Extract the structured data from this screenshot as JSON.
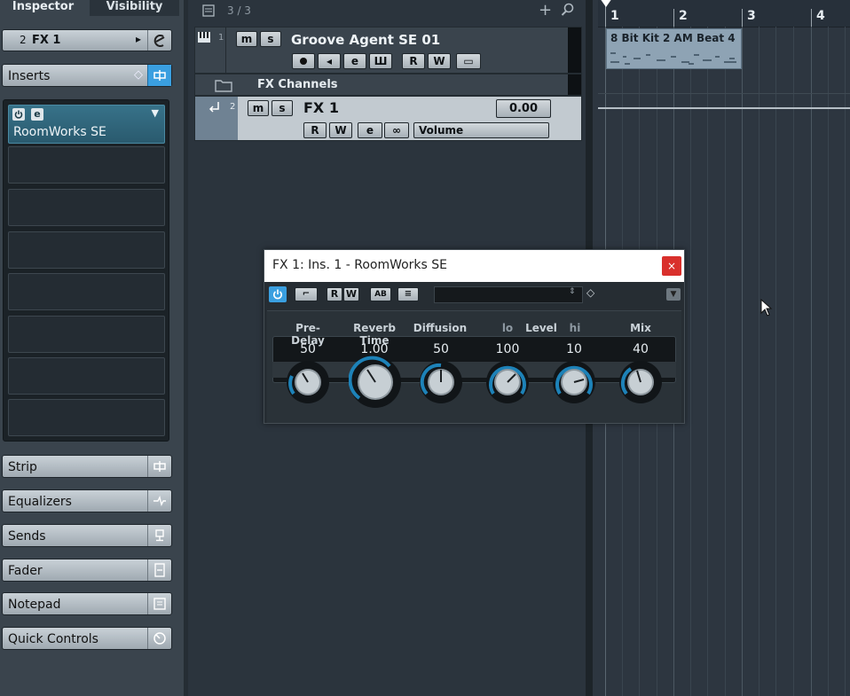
{
  "inspector": {
    "tabs": [
      "Inspector",
      "Visibility"
    ],
    "channel": {
      "number": "2",
      "name": "FX 1"
    },
    "inserts_label": "Inserts",
    "active_insert": "RoomWorks SE",
    "sections": [
      "Strip",
      "Equalizers",
      "Sends",
      "Fader",
      "Notepad",
      "Quick Controls"
    ]
  },
  "tracklist": {
    "count": "3 / 3",
    "tracks": [
      {
        "number": "1",
        "name": "Groove Agent SE 01"
      },
      {
        "name": "FX Channels"
      },
      {
        "number": "2",
        "name": "FX 1",
        "value": "0.00",
        "automation": "Volume"
      }
    ],
    "buttons": {
      "mute": "m",
      "solo": "s",
      "read": "R",
      "write": "W"
    }
  },
  "project": {
    "ruler": [
      "1",
      "2",
      "3",
      "4"
    ],
    "event_name": "8 Bit Kit 2 AM Beat 4"
  },
  "plugin": {
    "title": "FX 1: Ins. 1 - RoomWorks SE",
    "close": "×",
    "params": [
      {
        "label": "Pre-Delay",
        "value": "50"
      },
      {
        "label": "Reverb Time",
        "value": "1.00"
      },
      {
        "label": "Diffusion",
        "value": "50"
      },
      {
        "label": "lo",
        "value": "100"
      },
      {
        "label": "hi",
        "value": "10"
      },
      {
        "label": "Mix",
        "value": "40"
      }
    ],
    "level_label": "Level"
  },
  "colors": {
    "accent": "#3a9fe0",
    "insert_active": "#2f6a80",
    "close": "#d9302c"
  }
}
